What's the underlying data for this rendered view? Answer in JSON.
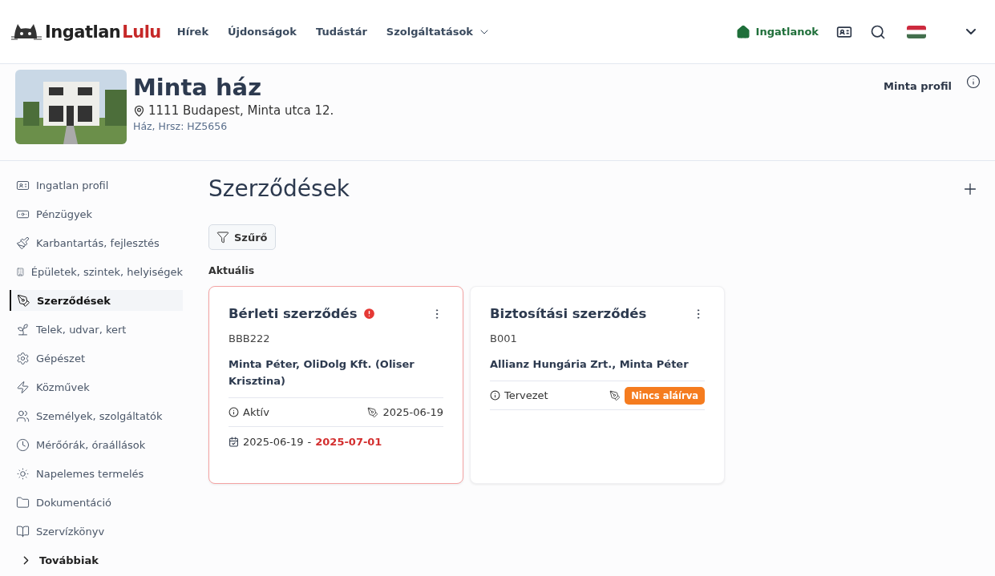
{
  "logo": {
    "part1": "Ingatlan",
    "part2": "Lulu"
  },
  "nav": [
    {
      "label": "Hírek",
      "kind": "link"
    },
    {
      "label": "Újdonságok",
      "kind": "link"
    },
    {
      "label": "Tudástár",
      "kind": "link"
    },
    {
      "label": "Szolgáltatások",
      "kind": "dropdown"
    }
  ],
  "properties_link": {
    "label": "Ingatlanok"
  },
  "property": {
    "name": "Minta ház",
    "address": "1111 Budapest, Minta utca 12.",
    "details": "Ház, Hrsz: HZ5656",
    "profile": "Minta profil"
  },
  "sidebar": {
    "items": [
      {
        "label": "Ingatlan profil",
        "kind": "idcard",
        "selected": false
      },
      {
        "label": "Pénzügyek",
        "kind": "money",
        "selected": false
      },
      {
        "label": "Karbantartás, fejlesztés",
        "kind": "brush",
        "selected": false
      },
      {
        "label": "Épületek, szintek, helyiségek",
        "kind": "building",
        "selected": false
      },
      {
        "label": "Szerződések",
        "kind": "pen",
        "selected": true
      },
      {
        "label": "Telek, udvar, kert",
        "kind": "sprout",
        "selected": false
      },
      {
        "label": "Gépészet",
        "kind": "gear",
        "selected": false
      },
      {
        "label": "Közművek",
        "kind": "bolt",
        "selected": false
      },
      {
        "label": "Személyek, szolgáltatók",
        "kind": "people",
        "selected": false
      },
      {
        "label": "Mérőórák, óraállások",
        "kind": "clock",
        "selected": false
      },
      {
        "label": "Napelemes termelés",
        "kind": "solar",
        "selected": false
      },
      {
        "label": "Dokumentáció",
        "kind": "folder",
        "selected": false
      },
      {
        "label": "Szervízkönyv",
        "kind": "book",
        "selected": false
      }
    ],
    "more": "Továbbiak"
  },
  "page": {
    "title": "Szerződések",
    "filter": "Szűrő",
    "section": "Aktuális"
  },
  "cards": [
    {
      "title": "Bérleti szerződés",
      "alert": true,
      "code": "BBB222",
      "parties": "Minta Péter, OliDolg Kft. (Oliser Krisztina)",
      "status": "Aktív",
      "signed": {
        "kind": "date",
        "text": "2025-06-19"
      },
      "period": {
        "start": "2025-06-19",
        "separator": "-",
        "end": "2025-07-01",
        "overdue": true
      }
    },
    {
      "title": "Biztosítási szerződés",
      "alert": false,
      "code": "B001",
      "parties": "Allianz Hungária Zrt., Minta Péter",
      "status": "Tervezet",
      "signed": {
        "kind": "badge",
        "text": "Nincs aláírva"
      }
    }
  ]
}
